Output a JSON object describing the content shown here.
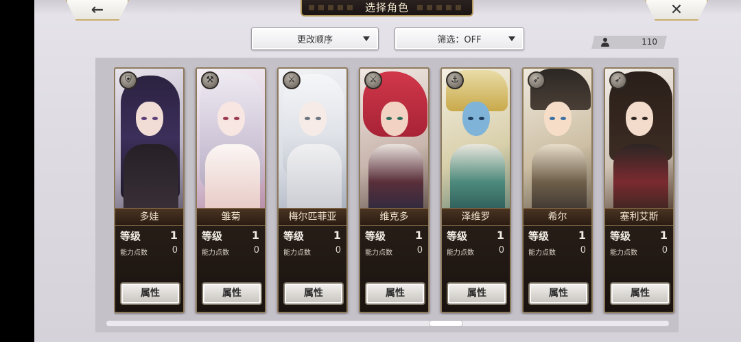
{
  "header": {
    "title": "选择角色",
    "back_icon": "←",
    "close_icon": "✕"
  },
  "controls": {
    "order_label": "更改顺序",
    "filter_label": "筛选：OFF",
    "character_count": "110"
  },
  "cards": [
    {
      "name": "多娃",
      "level_label": "等级",
      "level": "1",
      "points_label": "能力点数",
      "points": "0",
      "button": "属性",
      "class_icon": "shield-icon"
    },
    {
      "name": "雏菊",
      "level_label": "等级",
      "level": "1",
      "points_label": "能力点数",
      "points": "0",
      "button": "属性",
      "class_icon": "hammer-icon"
    },
    {
      "name": "梅尔匹菲亚",
      "level_label": "等级",
      "level": "1",
      "points_label": "能力点数",
      "points": "0",
      "button": "属性",
      "class_icon": "sword-icon"
    },
    {
      "name": "维克多",
      "level_label": "等级",
      "level": "1",
      "points_label": "能力点数",
      "points": "0",
      "button": "属性",
      "class_icon": "sword-icon"
    },
    {
      "name": "泽维罗",
      "level_label": "等级",
      "level": "1",
      "points_label": "能力点数",
      "points": "0",
      "button": "属性",
      "class_icon": "axe-icon"
    },
    {
      "name": "希尔",
      "level_label": "等级",
      "level": "1",
      "points_label": "能力点数",
      "points": "0",
      "button": "属性",
      "class_icon": "bow-icon"
    },
    {
      "name": "塞利艾斯",
      "level_label": "等级",
      "level": "1",
      "points_label": "能力点数",
      "points": "0",
      "button": "属性",
      "class_icon": "bow-icon"
    }
  ]
}
